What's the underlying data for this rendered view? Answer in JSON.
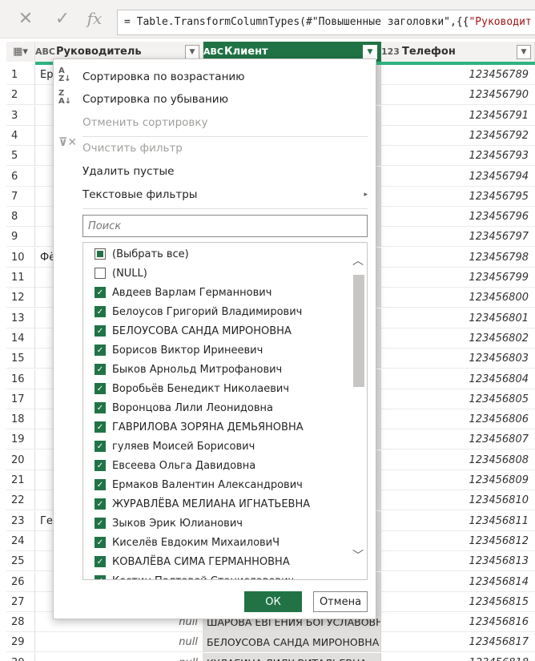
{
  "formula_bar": {
    "cancel_icon": "close-icon",
    "accept_icon": "check-icon",
    "fx_label": "fx",
    "prefix": "= Table.TransformColumnTypes(#\"Повышенные заголовки\",{{",
    "string_part": "\"Руководит"
  },
  "columns": [
    {
      "type": "ABC",
      "name": "Руководитель"
    },
    {
      "type": "ABC",
      "name": "Клиент"
    },
    {
      "type": "123",
      "name": "Телефон"
    }
  ],
  "rows": [
    {
      "n": "1",
      "c1": "Ерм",
      "c2": "",
      "c3": "123456789"
    },
    {
      "n": "2",
      "c1": "",
      "c2": "",
      "c3": "123456790"
    },
    {
      "n": "3",
      "c1": "",
      "c2": "",
      "c3": "123456791"
    },
    {
      "n": "4",
      "c1": "",
      "c2": "",
      "c3": "123456792"
    },
    {
      "n": "5",
      "c1": "",
      "c2": "",
      "c3": "123456793"
    },
    {
      "n": "6",
      "c1": "",
      "c2": "",
      "c3": "123456794"
    },
    {
      "n": "7",
      "c1": "",
      "c2": "",
      "c3": "123456795"
    },
    {
      "n": "8",
      "c1": "",
      "c2": "",
      "c3": "123456796"
    },
    {
      "n": "9",
      "c1": "",
      "c2": "",
      "c3": "123456797"
    },
    {
      "n": "10",
      "c1": "Фё",
      "c2": "",
      "c3": "123456798"
    },
    {
      "n": "11",
      "c1": "",
      "c2": "",
      "c3": "123456799"
    },
    {
      "n": "12",
      "c1": "",
      "c2": "",
      "c3": "123456800"
    },
    {
      "n": "13",
      "c1": "",
      "c2": "",
      "c3": "123456801"
    },
    {
      "n": "14",
      "c1": "",
      "c2": "",
      "c3": "123456802"
    },
    {
      "n": "15",
      "c1": "",
      "c2": "",
      "c3": "123456803"
    },
    {
      "n": "16",
      "c1": "",
      "c2": "",
      "c3": "123456804"
    },
    {
      "n": "17",
      "c1": "",
      "c2": "",
      "c3": "123456805"
    },
    {
      "n": "18",
      "c1": "",
      "c2": "",
      "c3": "123456806"
    },
    {
      "n": "19",
      "c1": "",
      "c2": "",
      "c3": "123456807"
    },
    {
      "n": "20",
      "c1": "",
      "c2": "",
      "c3": "123456808"
    },
    {
      "n": "21",
      "c1": "",
      "c2": "",
      "c3": "123456809"
    },
    {
      "n": "22",
      "c1": "",
      "c2": "",
      "c3": "123456810"
    },
    {
      "n": "23",
      "c1": "Гео",
      "c2": "",
      "c3": "123456811"
    },
    {
      "n": "24",
      "c1": "",
      "c2": "",
      "c3": "123456812"
    },
    {
      "n": "25",
      "c1": "",
      "c2": "",
      "c3": "123456813"
    },
    {
      "n": "26",
      "c1": "",
      "c2": "",
      "c3": "123456814"
    },
    {
      "n": "27",
      "c1": "",
      "c2": "",
      "c3": "123456815"
    },
    {
      "n": "28",
      "c1": "null",
      "c2": "ШАРОВА ЕВГЕНИЯ БОГУСЛАВОВНА",
      "c3": "123456816"
    },
    {
      "n": "29",
      "c1": "null",
      "c2": "БЕЛОУСОВА САНДА МИРОНОВНА",
      "c3": "123456817"
    },
    {
      "n": "30",
      "c1": "null",
      "c2": "КУЛАГИНА ЛИДУ ВИТАЛЬЕВНА",
      "c3": "123456818"
    }
  ],
  "menu": {
    "sort_asc": "Сортировка по возрастанию",
    "sort_desc": "Сортировка по убыванию",
    "clear_sort": "Отменить сортировку",
    "clear_filter": "Очистить фильтр",
    "remove_empty": "Удалить пустые",
    "text_filters": "Текстовые фильтры",
    "search_placeholder": "Поиск",
    "ok": "ОК",
    "cancel": "Отмена"
  },
  "filter_items": [
    {
      "label": "(Выбрать все)",
      "state": "partial"
    },
    {
      "label": "(NULL)",
      "state": "unchecked"
    },
    {
      "label": "Авдеев Варлам Германнович",
      "state": "checked"
    },
    {
      "label": "Белоусов Григорий Владимирович",
      "state": "checked"
    },
    {
      "label": "БЕЛОУСОВА САНДА МИРОНОВНА",
      "state": "checked"
    },
    {
      "label": "Борисов Виктор Иринеевич",
      "state": "checked"
    },
    {
      "label": "Быков Арнольд Митрофанович",
      "state": "checked"
    },
    {
      "label": "Воробьёв Бенедикт Николаевич",
      "state": "checked"
    },
    {
      "label": "Воронцова Лили Леонидовна",
      "state": "checked"
    },
    {
      "label": "ГАВРИЛОВА ЗОРЯНА ДЕМЬЯНОВНА",
      "state": "checked"
    },
    {
      "label": "гуляев Моисей Борисович",
      "state": "checked"
    },
    {
      "label": "Евсеева Ольга Давидовна",
      "state": "checked"
    },
    {
      "label": "Ермаков Валентин Александрович",
      "state": "checked"
    },
    {
      "label": "ЖУРАВЛЁВА МЕЛИАНА ИГНАТЬЕВНА",
      "state": "checked"
    },
    {
      "label": "Зыков Эрик Юлианович",
      "state": "checked"
    },
    {
      "label": "Киселёв Евдоким МихаиловиЧ",
      "state": "checked"
    },
    {
      "label": "КОВАЛЁВА СИМА ГЕРМАННОВНА",
      "state": "checked"
    },
    {
      "label": "Костин Полтавей Станиславович",
      "state": "checked"
    }
  ],
  "colors": {
    "accent": "#217346",
    "header_strip": "#2fb380"
  }
}
